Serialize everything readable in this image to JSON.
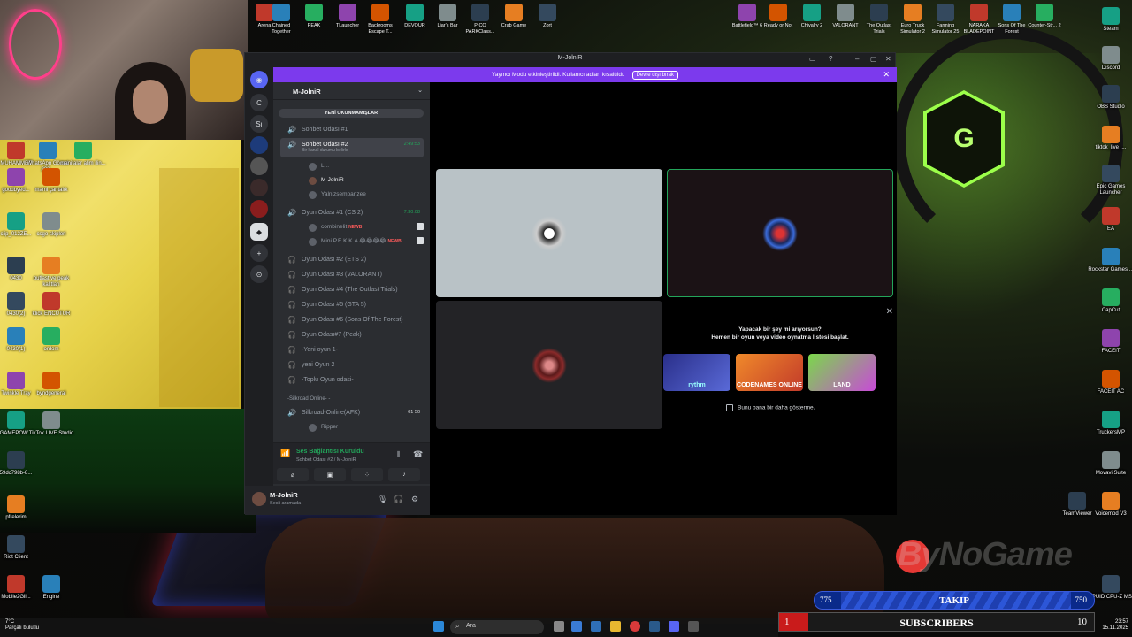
{
  "window": {
    "title": "M-JolniR"
  },
  "banner": {
    "text": "Yayıncı Modu etkinleştirildi. Kullanıcı adları kısaltıldı.",
    "button": "Devre dışı bırak"
  },
  "server": {
    "name": "M-JolniR",
    "unread_label": "YENİ OKUNMAMIŞLAR"
  },
  "guild_letters": [
    "C",
    "Sı"
  ],
  "channels": [
    {
      "name": "Sohbet Odası #1",
      "icon": "🔥"
    },
    {
      "name": "Sohbet Odası #2",
      "icon": "🔥",
      "time": "2:49:53",
      "status": "Bir kanal durumu belirle"
    },
    {
      "name": "Oyun Odası #1 (CS 2)",
      "time": "7:30:08"
    },
    {
      "name": "Oyun Odası #2 (ETS 2)"
    },
    {
      "name": "Oyun Odası #3 (VALORANT)"
    },
    {
      "name": "Oyun Odası #4 (The Outlast Trials)"
    },
    {
      "name": "Oyun Odası #5 (GTA 5)"
    },
    {
      "name": "Oyun Odası #6 (Sons Of The Forest)"
    },
    {
      "name": "Oyun Odası#7 (Peak)"
    },
    {
      "name": "-Yeni oyun 1-"
    },
    {
      "name": "yeni Oyun 2"
    },
    {
      "name": "-Toplu Oyun odasi-"
    }
  ],
  "voice_users_ch2": [
    "L...",
    "M-JolniR",
    "Yalnizsempanzee"
  ],
  "voice_users_cs2": [
    {
      "name": "combinelit",
      "badge": "NEWB"
    },
    {
      "name": "Mini P.E.K.K.A 😂😂😂😂",
      "badge": "NEWB"
    }
  ],
  "category": "-Silkroad Online- -",
  "silkroad": {
    "name": "Silkroad-Online(AFK)",
    "counts": "01 50",
    "user": "Ripper"
  },
  "voice_panel": {
    "status": "Ses Bağlantısı Kuruldu",
    "sub": "Sohbet Odası #2 / M-JolniR"
  },
  "user_panel": {
    "name": "M-JolniR",
    "status": "Sesli aramada"
  },
  "suggest": {
    "line1": "Yapacak bir şey mi arıyorsun?",
    "line2": "Hemen bir oyun veya video oynatma listesi başlat.",
    "cards": [
      "rythm",
      "CODENAMES ONLINE",
      "LAND"
    ],
    "checkbox": "Bunu bana bir daha gösterme."
  },
  "top_apps_left": [
    "Arena",
    "Chained Together",
    "PEAK",
    "TLauncher",
    "Backrooms Escape T...",
    "DEVOUR",
    "Liar's Bar",
    "PICO PARKClass...",
    "Crab Game",
    "Zort"
  ],
  "top_apps_right": [
    "Battlefield™ 6",
    "Ready or Not",
    "Chivalry 2",
    "VALORANT",
    "The Outlast Trials",
    "Euro Truck Simulator 2",
    "Farming Simulator 25",
    "NARAKA BLADEPOINT",
    "Sons Of The Forest",
    "Counter-Str... 2"
  ],
  "left_icons": [
    "MUHAMMET",
    "WhatsApp Görsel 202...",
    "manitalar alim ilin...",
    "goodbyed...",
    "mami çantalık",
    "clip_012ZE...",
    "csgo skipleri",
    "0430",
    "outlast ve peak kalıtları",
    "0430(2)",
    "klick ENCÜTUR",
    "0430(1)",
    "ordom",
    "Twinkle Tray",
    "byndgeneral",
    "GAMEPOW...",
    "TikTok LIVE Studio",
    "59dc798b-8...",
    "pfrelerim",
    "Riot Client",
    "Mobile2Gli...",
    "Engine"
  ],
  "right_icons": [
    "Steam",
    "Discord",
    "OBS Studio",
    "tiktok_live_...",
    "Epic Games Launcher",
    "EA",
    "Rockstar Games ...",
    "CapCut",
    "FACEIT",
    "FACEIT AC",
    "TruckersMP",
    "Movavi Suite",
    "TeamViewer",
    "Voicemod V3",
    "CPUID CPU-Z MSI"
  ],
  "watermark": "ByNoGame",
  "takip": {
    "label": "TAKIP",
    "left": "775",
    "right": "750"
  },
  "subs": {
    "label": "SUBSCRIBERS",
    "left": "1",
    "right": "10"
  },
  "taskbar": {
    "search": "Ara",
    "temp": "7°C",
    "weather": "Parçalı bulutlu",
    "time": "23:57",
    "date": "15.11.2025"
  }
}
